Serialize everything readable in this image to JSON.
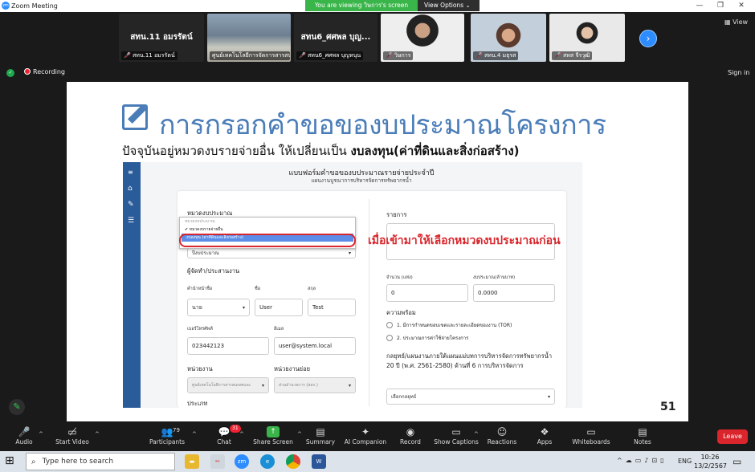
{
  "window": {
    "title": "Zoom Meeting",
    "viewing_banner": "You are viewing วิษการ's screen",
    "view_options": "View Options"
  },
  "gallery": {
    "tiles": [
      {
        "bigname": "สทน.11 อมรรัตน์",
        "label": "สทน.11 อมรรัตน์"
      },
      {
        "bigname": "",
        "label": "ศูนย์เทคโนโลยีการจัดการสารสนเทศ"
      },
      {
        "bigname": "สทน6_ศศพล  บุญ...",
        "label": "สทน6_ศศพล  บุญหนุน"
      },
      {
        "bigname": "",
        "label": "วิษการ"
      },
      {
        "bigname": "",
        "label": "สทน.4 มธุรส"
      },
      {
        "bigname": "",
        "label": "สทส จีรวุฒิ"
      }
    ],
    "view_label": "View"
  },
  "status": {
    "recording": "Recording",
    "signin": "Sign in"
  },
  "slide": {
    "title": "การกรอกคำขอของบประมาณโครงการ",
    "subtitle_prefix": "ปัจจุบันอยู่หมวดงบรายจ่ายอื่น ให้เปลี่ยนเป็น ",
    "subtitle_bold": "งบลงทุน(ค่าที่ดินและสิ่งก่อสร้าง)",
    "callout": "เมื่อเข้ามาให้เลือกหมวดงบประมาณก่อน",
    "page_number": "51",
    "form": {
      "heading": "แบบฟอร์มคำขอของบประมาณรายจ่ายประจำปี",
      "subheading": "แผนงานบูรณาการบริหารจัดการทรัพยากรน้ำ",
      "budget_category_label": "หมวดงบประมาณ",
      "dropdown_options": [
        "หมวดงบประมาณ",
        "✔ หมวดงบรายจ่ายอื่น",
        "งบลงทุน (ค่าที่ดินและสิ่งก่อสร้าง)"
      ],
      "budget_year_placeholder": "ปีงบประมาณ",
      "owner_section": "ผู้จัดทำ/ประสานงาน",
      "prefix_label": "คำนำหน้าชื่อ",
      "prefix_value": "นาย",
      "firstname_label": "ชื่อ",
      "firstname_value": "User",
      "lastname_label": "สกุล",
      "lastname_value": "Test",
      "phone_label": "เบอร์โทรศัพท์",
      "phone_value": "023442123",
      "email_label": "อีเมล",
      "email_value": "user@system.local",
      "unit_label": "หน่วยงาน",
      "unit_value": "ศูนย์เทคโนโลยีการสารสนเทศและ",
      "subunit_label": "หน่วยงานย่อย",
      "subunit_value": "ส่วนอำนวยการ (สอก.)",
      "type_label": "ประเภท",
      "item_label": "รายการ",
      "qty_label": "จำนวน (แห่ง)",
      "qty_value": "0",
      "budget_label": "งบประมาณ(ล้านบาท)",
      "budget_value": "0.0000",
      "readiness_label": "ความพร้อม",
      "readiness_items": [
        "1. มีการกำหนดขอบเขตและรายละเอียดของงาน (TOR)",
        "2. ประมาณการค่าใช้จ่ายโครงการ"
      ],
      "strategy_label": "กลยุทธ์/แผนงานภายใต้แผนแม่บทการบริหารจัดการทรัพยากรน้ำ 20 ปี (พ.ศ. 2561-2580) ด้านที่ 6 การบริหารจัดการ",
      "strategy_placeholder": "เลือกกลยุทธ์"
    }
  },
  "toolbar": {
    "audio": "Audio",
    "video": "Start Video",
    "participants": "Participants",
    "participants_count": "79",
    "chat": "Chat",
    "chat_badge": "31",
    "share": "Share Screen",
    "summary": "Summary",
    "companion": "AI Companion",
    "record": "Record",
    "captions": "Show Captions",
    "reactions": "Reactions",
    "apps": "Apps",
    "whiteboards": "Whiteboards",
    "notes": "Notes",
    "leave": "Leave"
  },
  "taskbar": {
    "search_placeholder": "Type here to search",
    "lang": "ENG",
    "time": "10:26",
    "date": "13/2/2567"
  }
}
